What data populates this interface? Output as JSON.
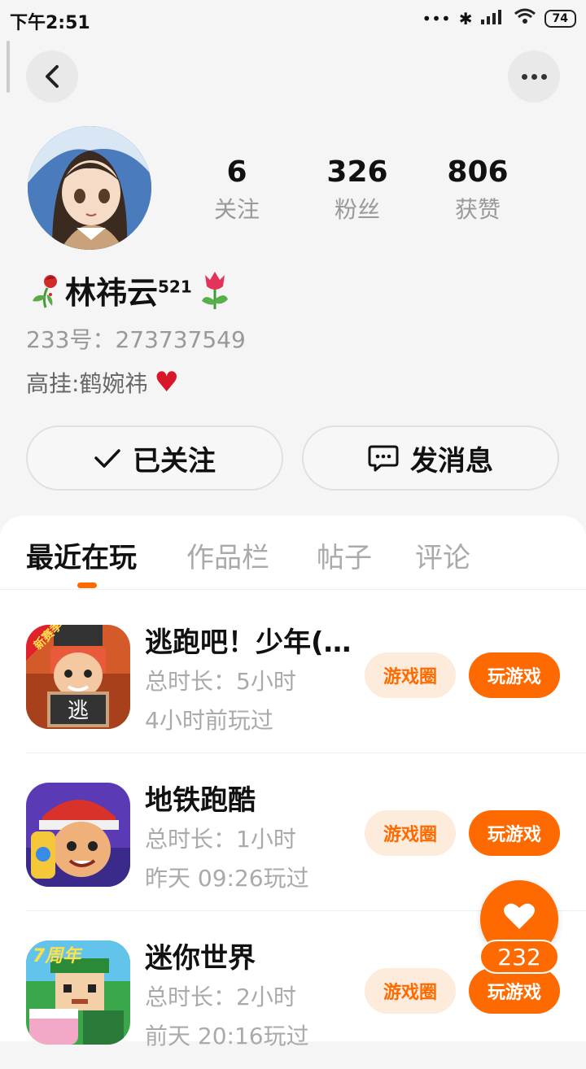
{
  "status_bar": {
    "time": "下午2:51",
    "battery": "74"
  },
  "profile": {
    "name": "林祎云",
    "name_sup": "521",
    "uid_label": "233号：",
    "uid": "273737549",
    "bio": "高挂:鹤婉祎",
    "stats": [
      {
        "value": "6",
        "label": "关注"
      },
      {
        "value": "326",
        "label": "粉丝"
      },
      {
        "value": "806",
        "label": "获赞"
      }
    ]
  },
  "actions": {
    "follow_label": "已关注",
    "message_label": "发消息"
  },
  "tabs": [
    "最近在玩",
    "作品栏",
    "帖子",
    "评论"
  ],
  "games": [
    {
      "title": "逃跑吧！少年(...",
      "duration": "总时长：5小时",
      "last_played": "4小时前玩过",
      "circle_label": "游戏圈",
      "play_label": "玩游戏"
    },
    {
      "title": "地铁跑酷",
      "duration": "总时长：1小时",
      "last_played": "昨天 09:26玩过",
      "circle_label": "游戏圈",
      "play_label": "玩游戏"
    },
    {
      "title": "迷你世界",
      "duration": "总时长：2小时",
      "last_played": "前天 20:16玩过",
      "circle_label": "游戏圈",
      "play_label": "玩游戏"
    }
  ],
  "like_count": "232",
  "colors": {
    "accent": "#ff6a00",
    "accent_light": "#fdebdb"
  }
}
